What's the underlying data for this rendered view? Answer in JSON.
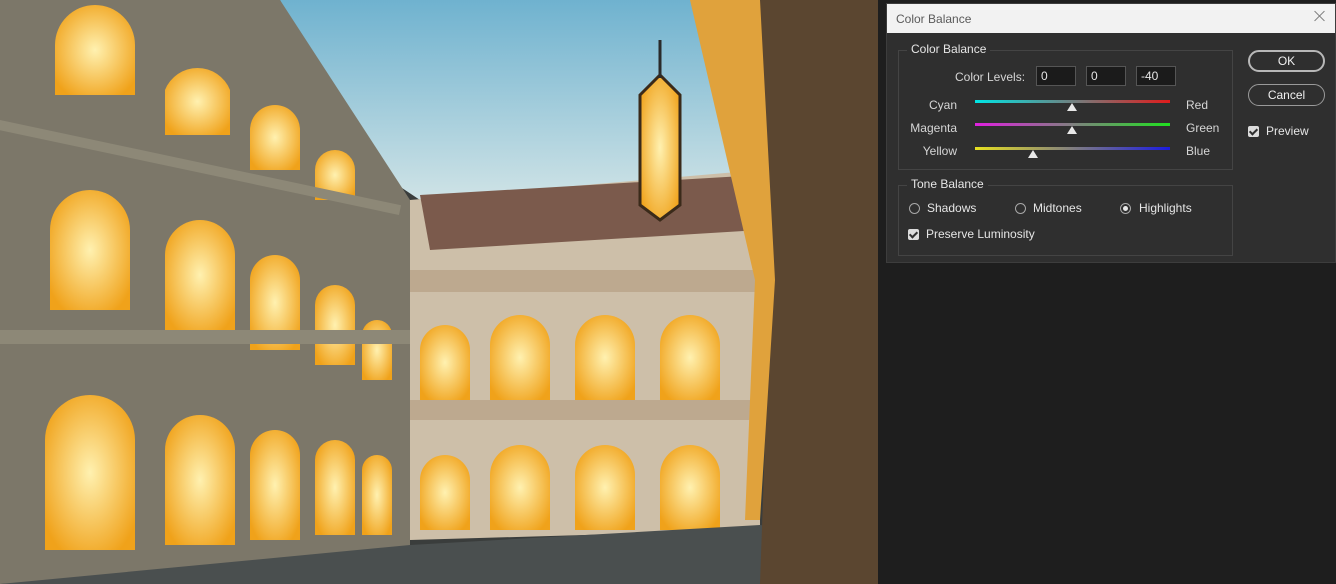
{
  "dialog": {
    "title": "Color Balance",
    "color_balance": {
      "legend": "Color Balance",
      "levels_label": "Color Levels:",
      "levels": [
        "0",
        "0",
        "-40"
      ],
      "sliders": [
        {
          "left": "Cyan",
          "right": "Red",
          "value": 0
        },
        {
          "left": "Magenta",
          "right": "Green",
          "value": 0
        },
        {
          "left": "Yellow",
          "right": "Blue",
          "value": -40
        }
      ]
    },
    "tone_balance": {
      "legend": "Tone Balance",
      "options": [
        "Shadows",
        "Midtones",
        "Highlights"
      ],
      "selected": "Highlights",
      "preserve_luminosity": "Preserve Luminosity",
      "preserve_luminosity_checked": true
    },
    "buttons": {
      "ok": "OK",
      "cancel": "Cancel"
    },
    "preview_label": "Preview",
    "preview_checked": true
  },
  "colors": {
    "dialog_bg": "#2f2f2f",
    "titlebar_bg": "#f2f2f2",
    "workspace_bg": "#1e1e1e"
  }
}
